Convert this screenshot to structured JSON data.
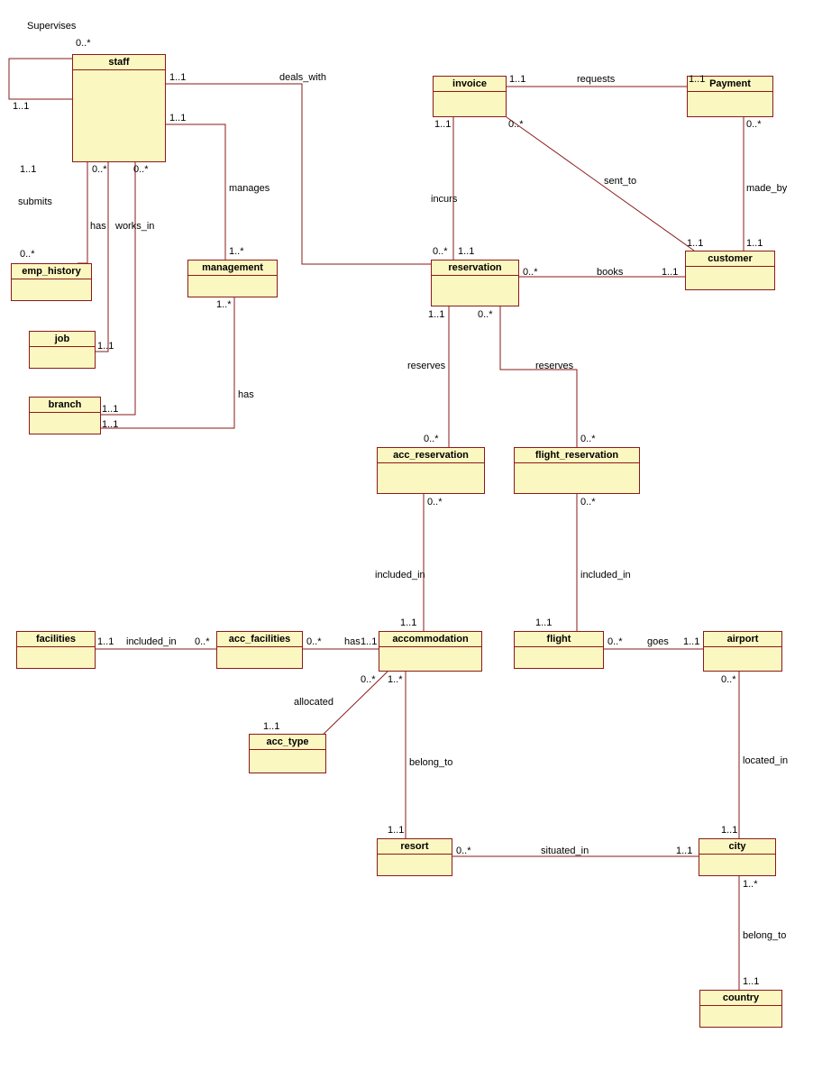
{
  "entities": {
    "staff": "staff",
    "invoice": "invoice",
    "payment": "Payment",
    "emp_history": "emp_history",
    "management": "management",
    "reservation": "reservation",
    "customer": "customer",
    "job": "job",
    "branch": "branch",
    "acc_reservation": "acc_reservation",
    "flight_reservation": "flight_reservation",
    "facilities": "facilities",
    "acc_facilities": "acc_facilities",
    "accommodation": "accommodation",
    "flight": "flight",
    "airport": "airport",
    "acc_type": "acc_type",
    "resort": "resort",
    "city": "city",
    "country": "country"
  },
  "relations": {
    "supervises": "Supervises",
    "deals_with": "deals_with",
    "requests": "requests",
    "submits": "submits",
    "has": "has",
    "works_in": "works_in",
    "manages": "manages",
    "incurs": "incurs",
    "sent_to": "sent_to",
    "made_by": "made_by",
    "books": "books",
    "reserves": "reserves",
    "included_in": "included_in",
    "goes": "goes",
    "allocated": "allocated",
    "belong_to": "belong_to",
    "situated_in": "situated_in",
    "located_in": "located_in"
  },
  "mult": {
    "one_one": "1..1",
    "zero_many": "0..*",
    "one_many": "1..*"
  },
  "chart_data": {
    "type": "uml_class_diagram",
    "entities": [
      "staff",
      "invoice",
      "Payment",
      "emp_history",
      "management",
      "reservation",
      "customer",
      "job",
      "branch",
      "acc_reservation",
      "flight_reservation",
      "facilities",
      "acc_facilities",
      "accommodation",
      "flight",
      "airport",
      "acc_type",
      "resort",
      "city",
      "country"
    ],
    "associations": [
      {
        "from": "staff",
        "to": "staff",
        "name": "Supervises",
        "from_mult": "1..1",
        "to_mult": "0..*"
      },
      {
        "from": "staff",
        "to": "reservation",
        "name": "deals_with",
        "from_mult": "1..1",
        "to_mult": "0..*"
      },
      {
        "from": "invoice",
        "to": "Payment",
        "name": "requests",
        "from_mult": "1..1",
        "to_mult": "1..1"
      },
      {
        "from": "staff",
        "to": "emp_history",
        "name": "submits",
        "from_mult": "1..1",
        "to_mult": "0..*"
      },
      {
        "from": "staff",
        "to": "job",
        "name": "has",
        "from_mult": "0..*",
        "to_mult": "1..1"
      },
      {
        "from": "staff",
        "to": "branch",
        "name": "works_in",
        "from_mult": "0..*",
        "to_mult": "1..1"
      },
      {
        "from": "staff",
        "to": "management",
        "name": "manages",
        "from_mult": "1..1",
        "to_mult": "1..*"
      },
      {
        "from": "management",
        "to": "branch",
        "name": "has",
        "from_mult": "1..*",
        "to_mult": "1..1"
      },
      {
        "from": "invoice",
        "to": "reservation",
        "name": "incurs",
        "from_mult": "1..1",
        "to_mult": "1..1"
      },
      {
        "from": "invoice",
        "to": "customer",
        "name": "sent_to",
        "from_mult": "0..*",
        "to_mult": "1..1"
      },
      {
        "from": "Payment",
        "to": "customer",
        "name": "made_by",
        "from_mult": "0..*",
        "to_mult": "1..1"
      },
      {
        "from": "reservation",
        "to": "customer",
        "name": "books",
        "from_mult": "0..*",
        "to_mult": "1..1"
      },
      {
        "from": "reservation",
        "to": "acc_reservation",
        "name": "reserves",
        "from_mult": "1..1",
        "to_mult": "0..*"
      },
      {
        "from": "reservation",
        "to": "flight_reservation",
        "name": "reserves",
        "from_mult": "1..1",
        "to_mult": "0..*"
      },
      {
        "from": "acc_reservation",
        "to": "accommodation",
        "name": "included_in",
        "from_mult": "0..*",
        "to_mult": "1..1"
      },
      {
        "from": "flight_reservation",
        "to": "flight",
        "name": "included_in",
        "from_mult": "0..*",
        "to_mult": "1..1"
      },
      {
        "from": "facilities",
        "to": "acc_facilities",
        "name": "included_in",
        "from_mult": "1..1",
        "to_mult": "0..*"
      },
      {
        "from": "acc_facilities",
        "to": "accommodation",
        "name": "has",
        "from_mult": "0..*",
        "to_mult": "1..1"
      },
      {
        "from": "flight",
        "to": "airport",
        "name": "goes",
        "from_mult": "0..*",
        "to_mult": "1..1"
      },
      {
        "from": "acc_type",
        "to": "accommodation",
        "name": "allocated",
        "from_mult": "1..1",
        "to_mult": "0..*"
      },
      {
        "from": "accommodation",
        "to": "resort",
        "name": "belong_to",
        "from_mult": "1..*",
        "to_mult": "1..1"
      },
      {
        "from": "resort",
        "to": "city",
        "name": "situated_in",
        "from_mult": "0..*",
        "to_mult": "1..1"
      },
      {
        "from": "airport",
        "to": "city",
        "name": "located_in",
        "from_mult": "0..*",
        "to_mult": "1..1"
      },
      {
        "from": "city",
        "to": "country",
        "name": "belong_to",
        "from_mult": "1..*",
        "to_mult": "1..1"
      }
    ]
  }
}
